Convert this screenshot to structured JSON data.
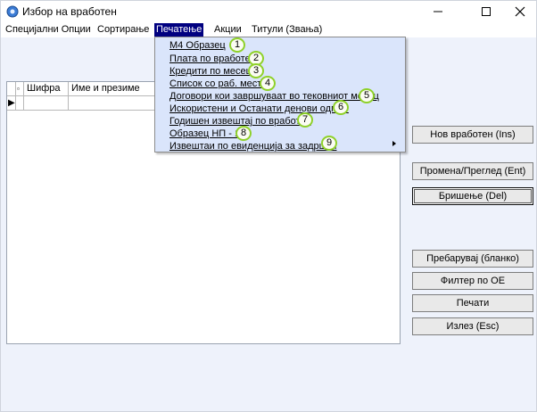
{
  "window": {
    "title": "Избор на вработен"
  },
  "menubar": {
    "items": [
      {
        "label": "Специјални Опции"
      },
      {
        "label": "Сортирање"
      },
      {
        "label": "Печатење"
      },
      {
        "label": "Акции"
      },
      {
        "label": "Титули (Звања)"
      }
    ]
  },
  "dropdown": {
    "items": [
      {
        "label": "М4 Образец",
        "badge": "1"
      },
      {
        "label": "Плата по вработен",
        "badge": "2"
      },
      {
        "label": "Кредити по месеци",
        "badge": "3"
      },
      {
        "label": "Список со раб. места",
        "badge": "4"
      },
      {
        "label": "Договори кои завршуваат во тековниот месец",
        "badge": "5"
      },
      {
        "label": "Искористени и Останати денови одмор",
        "badge": "6"
      },
      {
        "label": "Годишен извештај по вработен",
        "badge": "7"
      },
      {
        "label": "Образец НП - 1",
        "badge": "8"
      },
      {
        "label": "Извештаи по евиденција за задршки",
        "badge": "9",
        "has_submenu": true
      }
    ]
  },
  "grid": {
    "columns": [
      "",
      "Шифра",
      "Име и презиме"
    ],
    "row_indicator": "▶"
  },
  "buttons": {
    "new_employee": "Нов вработен (Ins)",
    "change_view": "Промена/Преглед (Ent)",
    "delete": "Бришење (Del)",
    "search": "Пребарувај (бланко)",
    "filter": "Филтер по ОЕ",
    "print": "Печати",
    "exit": "Излез (Esc)"
  },
  "colors": {
    "menu_active_bg": "#000080",
    "dropdown_bg": "#dae5fb",
    "badge_border": "#8fd12a",
    "window_bg": "#eef2fb"
  }
}
